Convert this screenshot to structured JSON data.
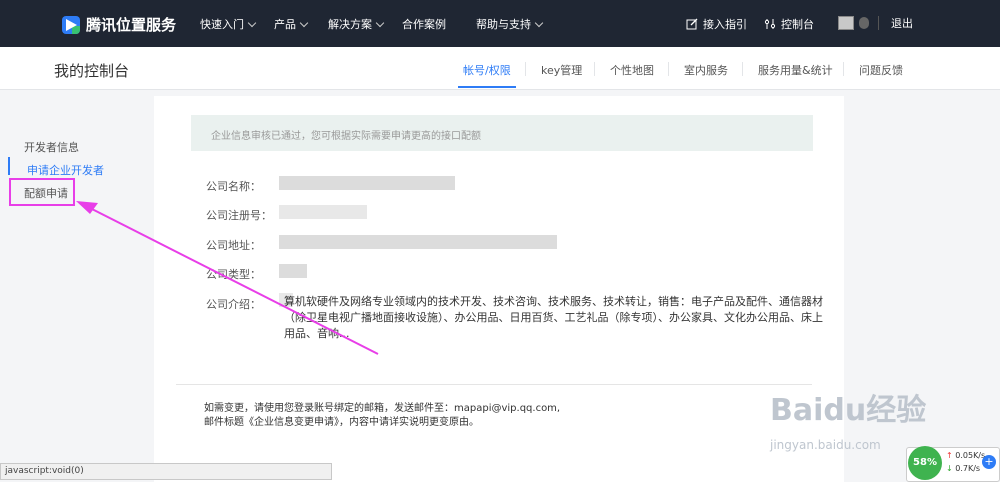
{
  "topnav": {
    "brand": "腾讯位置服务",
    "items": [
      {
        "label": "快速入门",
        "has_caret": true
      },
      {
        "label": "产品",
        "has_caret": true
      },
      {
        "label": "解决方案",
        "has_caret": true
      },
      {
        "label": "合作案例",
        "has_caret": false
      },
      {
        "label": "帮助与支持",
        "has_caret": true
      }
    ],
    "right": {
      "guide": "接入指引",
      "console": "控制台",
      "logout": "退出"
    }
  },
  "subheader": {
    "title": "我的控制台",
    "tabs": [
      "帐号/权限",
      "key管理",
      "个性地图",
      "室内服务",
      "服务用量&统计",
      "问题反馈"
    ],
    "active_tab": "帐号/权限"
  },
  "sidebar": {
    "group": "开发者信息",
    "items": [
      "申请企业开发者",
      "配额申请"
    ],
    "active": "申请企业开发者",
    "highlighted": "配额申请"
  },
  "main": {
    "notice": "企业信息审核已通过，您可根据实际需要申请更高的接口配额",
    "fields": {
      "company_name": "公司名称：",
      "company_reg": "公司注册号：",
      "company_addr": "公司地址：",
      "company_type": "公司类型：",
      "company_intro": "公司介绍："
    },
    "intro_text": "算机软硬件及网络专业领域内的技术开发、技术咨询、技术服务、技术转让，销售：电子产品及配件、通信器材（除卫星电视广播地面接收设施）、办公用品、日用百货、工艺礼品（除专项）、办公家具、文化办公用品、床上用品、音响...",
    "footer_line1": "如需变更，请使用您登录账号绑定的邮箱，发送邮件至：mapapi@vip.qq.com,",
    "footer_line2": "邮件标题《企业信息变更申请》，内容中请详实说明更变原由。"
  },
  "statusbar": {
    "text": "javascript:void(0)"
  },
  "net_widget": {
    "percent": "58%",
    "up": "0.05K/s",
    "down": "0.7K/s"
  },
  "watermark": {
    "main": "Baidu经验",
    "sub": "jingyan.baidu.com"
  },
  "colors": {
    "nav_bg": "#1f2633",
    "accent": "#2e7cf6",
    "annotation": "#e83ee8"
  }
}
